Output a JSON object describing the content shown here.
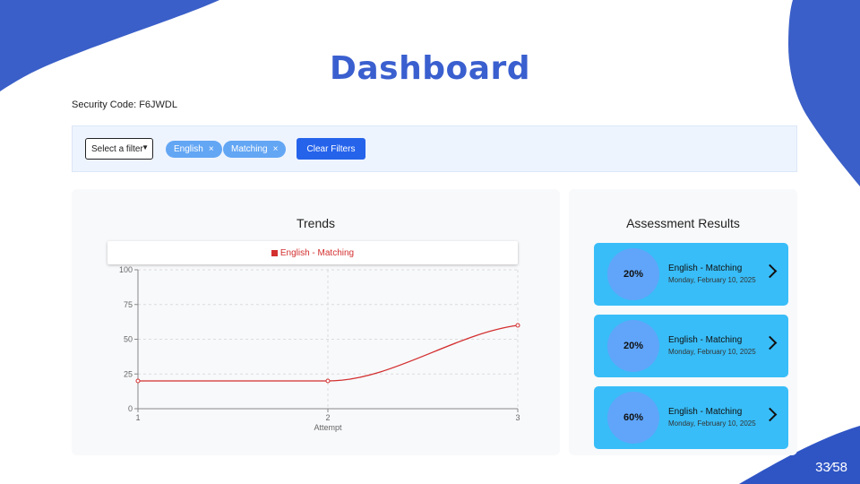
{
  "theme": {
    "accent": "#3a5fcf",
    "chip": "#63a6f4",
    "button": "#2563eb",
    "card": "#38bdf8",
    "card_circle": "#60a5fa",
    "series": "#d32f2f"
  },
  "page": {
    "title": "Dashboard",
    "security_code": "Security Code: F6JWDL",
    "page_number": "33⁄58"
  },
  "filters": {
    "select_value": "Select a filter",
    "chips": [
      {
        "label": "English"
      },
      {
        "label": "Matching"
      }
    ],
    "chip_remove_glyph": "×",
    "clear_label": "Clear Filters"
  },
  "trends": {
    "title": "Trends",
    "legend": "English - Matching",
    "xlabel": "Attempt"
  },
  "chart_data": {
    "type": "line",
    "title": "Trends",
    "xlabel": "Attempt",
    "ylabel": "",
    "x": [
      1,
      2,
      3
    ],
    "xlim": [
      1,
      3
    ],
    "ylim": [
      0,
      100
    ],
    "yticks": [
      0,
      25,
      50,
      75,
      100
    ],
    "grid": true,
    "legend_position": "top",
    "series": [
      {
        "name": "English - Matching",
        "color": "#d32f2f",
        "values": [
          20,
          20,
          60
        ]
      }
    ]
  },
  "results": {
    "title": "Assessment Results",
    "items": [
      {
        "score": "20%",
        "title": "English - Matching",
        "date": "Monday, February 10, 2025"
      },
      {
        "score": "20%",
        "title": "English - Matching",
        "date": "Monday, February 10, 2025"
      },
      {
        "score": "60%",
        "title": "English - Matching",
        "date": "Monday, February 10, 2025"
      }
    ]
  }
}
